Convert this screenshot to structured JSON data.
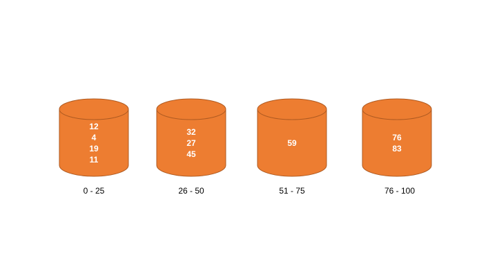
{
  "colors": {
    "cylinder_fill": "#ED7D31",
    "cylinder_stroke": "#AE5A21",
    "value_text": "#FFFFFF",
    "label_text": "#000000"
  },
  "buckets": [
    {
      "range_label": "0 - 25",
      "values": [
        "12",
        "4",
        "19",
        "11"
      ]
    },
    {
      "range_label": "26 - 50",
      "values": [
        "32",
        "27",
        "45"
      ]
    },
    {
      "range_label": "51 - 75",
      "values": [
        "59"
      ]
    },
    {
      "range_label": "76 - 100",
      "values": [
        "76",
        "83"
      ]
    }
  ]
}
